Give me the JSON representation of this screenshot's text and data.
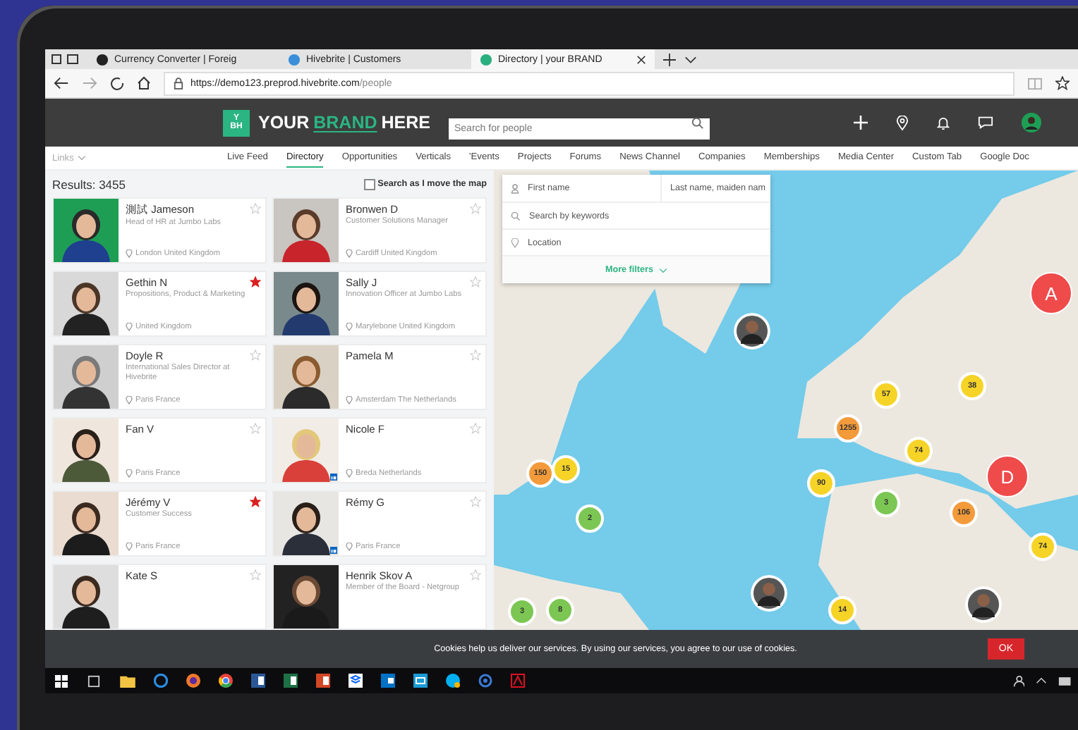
{
  "browser": {
    "tabs": [
      {
        "title": "Currency Converter | Foreig",
        "selected": false
      },
      {
        "title": "Hivebrite | Customers",
        "selected": false
      },
      {
        "title": "Directory | your BRAND",
        "selected": true
      }
    ],
    "url": {
      "host": "https://demo123.preprod.hivebrite.com",
      "path": "/people"
    }
  },
  "header": {
    "logo_top": "Y",
    "logo_bottom": "BH",
    "brand": [
      {
        "text": "YOUR",
        "highlight": false
      },
      {
        "text": "BRAND",
        "highlight": true
      },
      {
        "text": "HERE",
        "highlight": false
      }
    ],
    "search": {
      "placeholder": "Search for people"
    }
  },
  "nav": {
    "links": "Links",
    "items": [
      {
        "label": "Live Feed",
        "selected": false
      },
      {
        "label": "Directory",
        "selected": true
      },
      {
        "label": "Opportunities",
        "selected": false
      },
      {
        "label": "Verticals",
        "selected": false
      },
      {
        "label": "'Events",
        "selected": false
      },
      {
        "label": "Projects",
        "selected": false
      },
      {
        "label": "Forums",
        "selected": false
      },
      {
        "label": "News Channel",
        "selected": false
      },
      {
        "label": "Companies",
        "selected": false
      },
      {
        "label": "Memberships",
        "selected": false
      },
      {
        "label": "Media Center",
        "selected": false
      },
      {
        "label": "Custom Tab",
        "selected": false
      },
      {
        "label": "Google Doc",
        "selected": false
      }
    ]
  },
  "results": {
    "count": "Results: 3455",
    "map_search": {
      "label": "Search as I move the map",
      "checked": false
    }
  },
  "people": [
    {
      "name": "測試 Jameson",
      "title": "Head of HR at Jumbo Labs",
      "location": "London United Kingdom",
      "starred": false,
      "linked": false
    },
    {
      "name": "Bronwen D",
      "title": "Customer Solutions Manager",
      "location": "Cardiff United Kingdom",
      "starred": false,
      "linked": false
    },
    {
      "name": "Gethin N",
      "title": "Propositions, Product & Marketing",
      "location": "United Kingdom",
      "starred": true,
      "linked": false
    },
    {
      "name": "Sally J",
      "title": "Innovation Officer at Jumbo Labs",
      "location": "Marylebone United Kingdom",
      "starred": false,
      "linked": false
    },
    {
      "name": "Doyle R",
      "title": "International Sales Director at Hivebrite",
      "location": "Paris France",
      "starred": false,
      "linked": false
    },
    {
      "name": "Pamela M",
      "location": "Amsterdam The Netherlands",
      "starred": false,
      "linked": false
    },
    {
      "name": "Fan V",
      "location": "Paris France",
      "starred": false,
      "linked": false
    },
    {
      "name": "Nicole F",
      "location": "Breda Netherlands",
      "starred": false,
      "linked": true
    },
    {
      "name": "Jérémy V",
      "title": "Customer Success",
      "location": "Paris France",
      "starred": true,
      "linked": false
    },
    {
      "name": "Rémy G",
      "location": "Paris France",
      "starred": false,
      "linked": true
    },
    {
      "name": "Kate S",
      "starred": false,
      "linked": false
    },
    {
      "name": "Henrik Skov A",
      "title": "Member of the Board - Netgroup",
      "starred": false,
      "linked": false
    }
  ],
  "filters": {
    "first_name": {
      "placeholder": "First name"
    },
    "last_name": {
      "placeholder": "Last name, maiden nam"
    },
    "keywords": {
      "placeholder": "Search by keywords"
    },
    "location": {
      "placeholder": "Location"
    },
    "more": "More filters"
  },
  "map": {
    "markers": [
      {
        "kind": "avatar"
      },
      {
        "kind": "letter",
        "label": "A",
        "color": "#ef4b4b"
      },
      {
        "kind": "cluster",
        "label": "57",
        "color": "#f6d327"
      },
      {
        "kind": "cluster",
        "label": "38",
        "color": "#f6d327"
      },
      {
        "kind": "cluster",
        "label": "1255",
        "color": "#f39a3a"
      },
      {
        "kind": "cluster",
        "label": "74",
        "color": "#f6d327"
      },
      {
        "kind": "cluster",
        "label": "150",
        "color": "#f39a3a"
      },
      {
        "kind": "cluster",
        "label": "15",
        "color": "#f6d327"
      },
      {
        "kind": "cluster",
        "label": "90",
        "color": "#f6d327"
      },
      {
        "kind": "letter",
        "label": "D",
        "color": "#ef4b4b"
      },
      {
        "kind": "cluster",
        "label": "2",
        "color": "#7cc653"
      },
      {
        "kind": "cluster",
        "label": "3",
        "color": "#7cc653"
      },
      {
        "kind": "cluster",
        "label": "106",
        "color": "#f39a3a"
      },
      {
        "kind": "cluster",
        "label": "74",
        "color": "#f6d327"
      },
      {
        "kind": "avatar"
      },
      {
        "kind": "cluster",
        "label": "3",
        "color": "#7cc653"
      },
      {
        "kind": "cluster",
        "label": "8",
        "color": "#7cc653"
      },
      {
        "kind": "cluster",
        "label": "14",
        "color": "#f6d327"
      },
      {
        "kind": "avatar"
      }
    ]
  },
  "cookie_bar": {
    "text": "Cookies help us deliver our services. By using our services, you agree to our use of cookies.",
    "button": "OK"
  }
}
